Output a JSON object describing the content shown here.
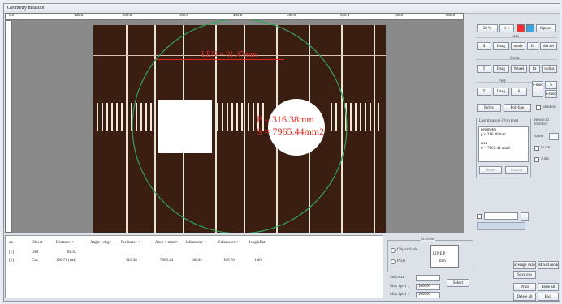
{
  "window": {
    "title": "Geometry measure"
  },
  "ruler": {
    "h_ticks": [
      "0.0",
      "100.0",
      "200.0",
      "300.0",
      "400.0",
      "500.0",
      "600.0",
      "700.0",
      "800.0"
    ]
  },
  "overlay": {
    "line_measure": "LEN = 81.47mm",
    "circle_perimeter": "P = 316.38mm",
    "circle_area": "S = 7965.44mm2"
  },
  "table": {
    "headers": [
      "no.",
      "Object",
      "Distance <-",
      "Angle <deg>",
      "Perimeter <-",
      "Area <-mm2>",
      "Ldiameter <-",
      "Sdiameter <-",
      "lengthRat"
    ],
    "rows": [
      [
        "[1]",
        "Dist",
        "81.47",
        "",
        "",
        "",
        "",
        "",
        ""
      ],
      [
        "[2]",
        "Circ",
        "100.71 (rad)",
        "",
        "316.38",
        "7965.44",
        "100.63",
        "100.76",
        "1.00"
      ]
    ]
  },
  "toolbar": {
    "zoom": "50 %",
    "zoom2": "1 ×",
    "option_label": "Option",
    "color": "#ff2a2a",
    "color2": "#39a5e8"
  },
  "sections": {
    "line": {
      "title": "Line",
      "buttons": [
        "S",
        "Drag",
        "mode",
        "fit",
        "del sel"
      ]
    },
    "circle": {
      "title": "Circle",
      "buttons": [
        "T",
        "Drag",
        "Wheel",
        "fit",
        "radius"
      ]
    },
    "poly": {
      "title": "Poly",
      "buttons": [
        "T",
        "Drag",
        "S",
        "c-mode",
        "S",
        "n-mode"
      ]
    },
    "shape_buttons": [
      "Polyg",
      "Polyline"
    ],
    "shadow_label": "Shadow",
    "info_title": "Last measure (Polygon)",
    "info_lines": [
      "perimeter",
      "p = 316.38 mm",
      "area",
      "S = 7965.44 mm2"
    ],
    "info_buttons": [
      "Reset",
      "Cancel"
    ],
    "right_title": "Result to memory",
    "right_fields": [
      "name",
      "in cm",
      "Auto"
    ]
  },
  "lower_panel": {
    "scale_title": "Scale set",
    "options": [
      "Object Scale",
      "Pixel"
    ],
    "line_label": "LINE P",
    "unit": "mm",
    "buttons": [
      "Select"
    ],
    "fields": [
      {
        "label": "Max 1pt 1 :",
        "value": "100000"
      },
      {
        "label": "Max 2pt 1 :",
        "value": "100000"
      }
    ],
    "step_label": "Step size"
  },
  "bottom_buttons": [
    "average value",
    "Mixed mode",
    "Save grp",
    "Print",
    "Paste all",
    "Delete all",
    "Exit"
  ]
}
